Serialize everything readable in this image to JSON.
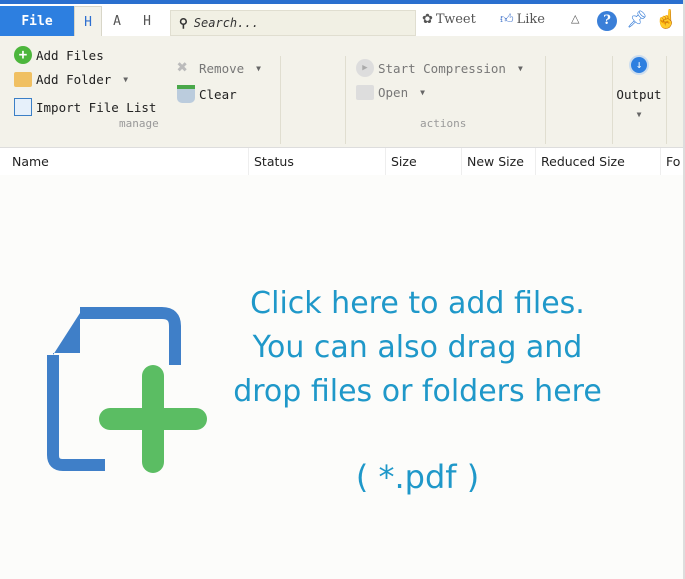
{
  "tabs": {
    "file": "File",
    "items": [
      "H",
      "A",
      "H"
    ]
  },
  "search": {
    "placeholder": "Search..."
  },
  "social": {
    "tweet": "Tweet",
    "like": "Like"
  },
  "manage": {
    "add_files": "Add Files",
    "add_folder": "Add Folder",
    "import_list": "Import File List",
    "remove": "Remove",
    "clear": "Clear",
    "label": "manage"
  },
  "actions": {
    "start": "Start Compression",
    "open": "Open",
    "label": "actions"
  },
  "output": {
    "label": "Output"
  },
  "columns": [
    "Name",
    "Status",
    "Size",
    "New Size",
    "Reduced Size",
    "Fo"
  ],
  "drop": {
    "line1": "Click here to add files.",
    "line2": "You can also drag and",
    "line3": "drop files or folders here",
    "ext": "( *.pdf )"
  },
  "colors": {
    "accent": "#2d7fe0",
    "drop_text": "#1f98c9",
    "icon_blue": "#3f7fc8",
    "icon_green": "#5bbd63"
  }
}
